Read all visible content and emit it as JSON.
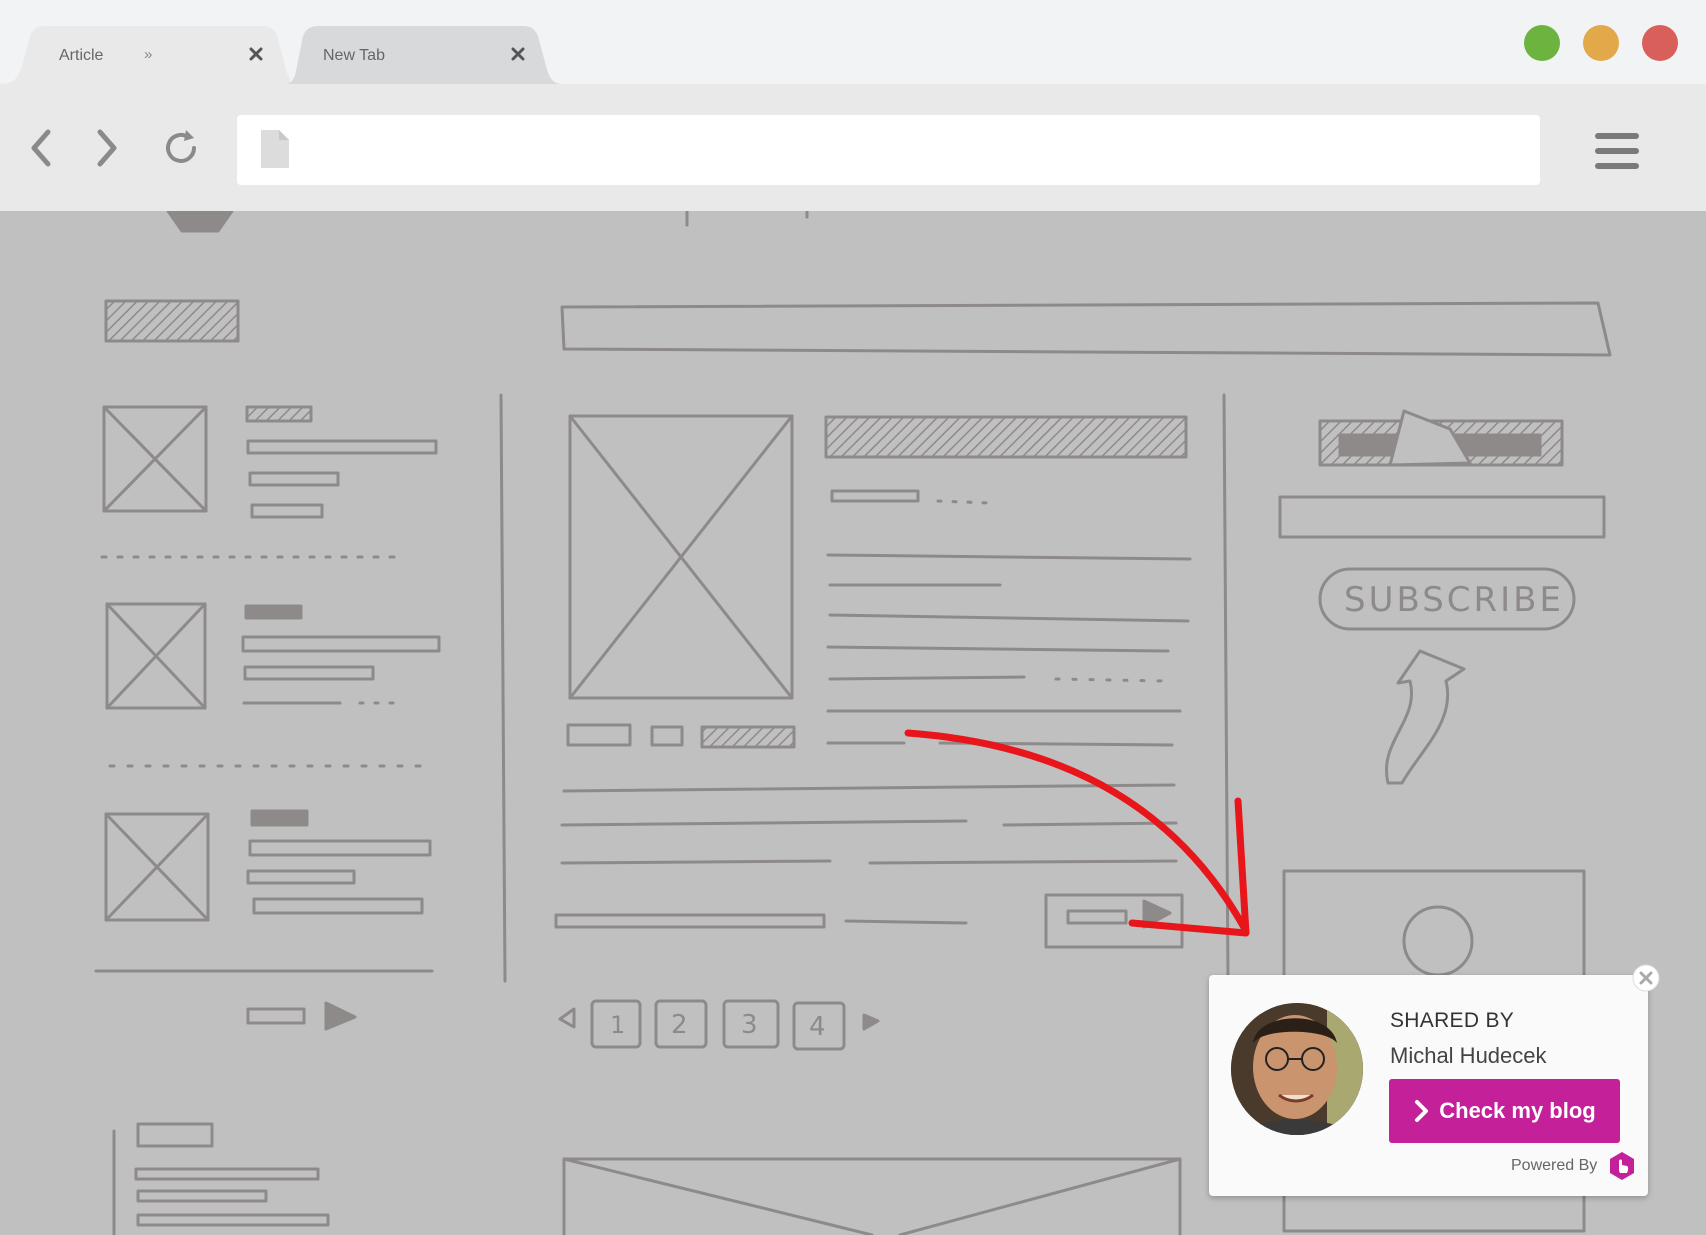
{
  "tabs": [
    {
      "label": "Article",
      "extra": "»",
      "close": "✕"
    },
    {
      "label": "New Tab",
      "close": "✕"
    }
  ],
  "window_controls": {
    "colors": [
      "#6db33f",
      "#e3a84a",
      "#d9605a"
    ]
  },
  "address_bar": {
    "value": "",
    "placeholder": ""
  },
  "toolbar": {
    "back_icon": "chevron-left-icon",
    "forward_icon": "chevron-right-icon",
    "reload_icon": "reload-icon",
    "menu_icon": "hamburger-icon"
  },
  "wireframe": {
    "subscribe_label": "SUBSCRIBE",
    "pagination": [
      "1",
      "2",
      "3",
      "4"
    ]
  },
  "widget": {
    "shared_by_label": "SHARED BY",
    "author_name": "Michal Hudecek",
    "button_label": "Check my blog",
    "button_icon": "chevron-right-icon",
    "powered_by_label": "Powered By",
    "accent_color": "#c4209a"
  }
}
